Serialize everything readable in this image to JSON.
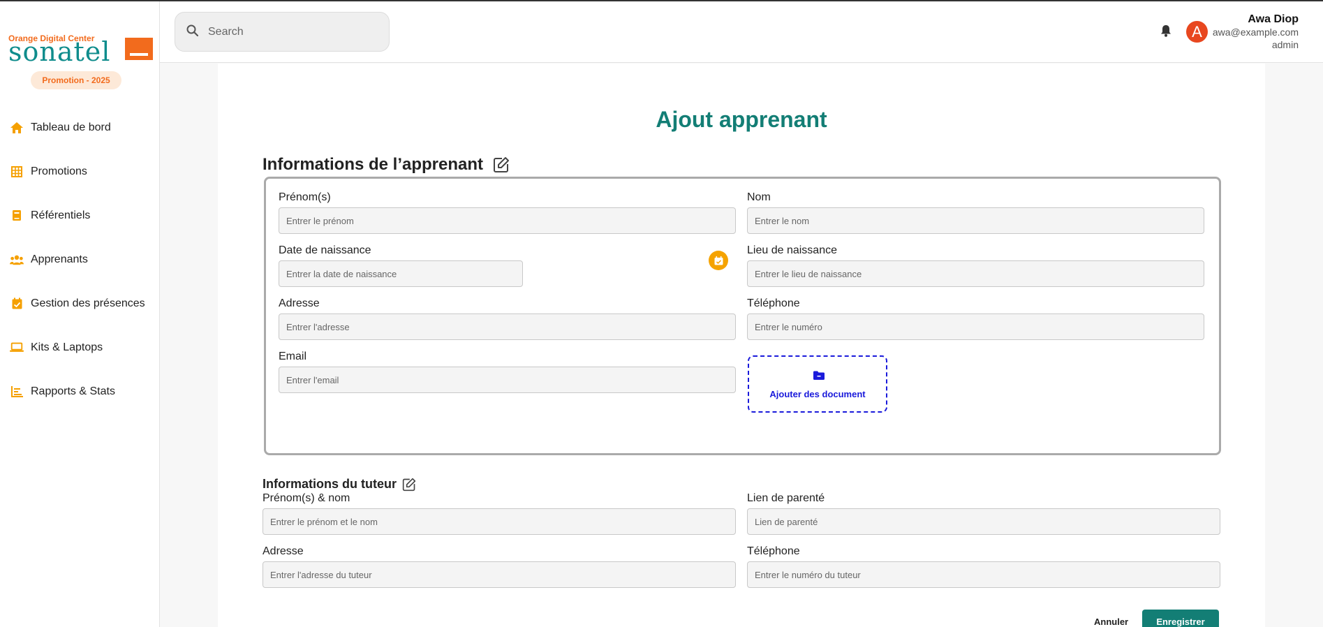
{
  "sidebar": {
    "logo_subtitle": "Orange Digital Center",
    "logo_text": "sonatel",
    "promotion_badge": "Promotion - 2025",
    "items": [
      {
        "label": "Tableau de bord",
        "icon": "home-icon"
      },
      {
        "label": "Promotions",
        "icon": "grid-icon"
      },
      {
        "label": "Référentiels",
        "icon": "book-icon"
      },
      {
        "label": "Apprenants",
        "icon": "users-icon"
      },
      {
        "label": "Gestion des présences",
        "icon": "calendar-check-icon"
      },
      {
        "label": "Kits & Laptops",
        "icon": "laptop-icon"
      },
      {
        "label": "Rapports & Stats",
        "icon": "bar-chart-icon"
      }
    ]
  },
  "header": {
    "search_placeholder": "Search",
    "user": {
      "initial": "A",
      "name": "Awa Diop",
      "email": "awa@example.com",
      "role": "admin"
    }
  },
  "form": {
    "title": "Ajout apprenant",
    "learner_section": {
      "title": "Informations de l’apprenant",
      "fields": {
        "prenom": {
          "label": "Prénom(s)",
          "placeholder": "Entrer le prénom",
          "value": ""
        },
        "nom": {
          "label": "Nom",
          "placeholder": "Entrer le nom",
          "value": ""
        },
        "date_naissance": {
          "label": "Date de naissance",
          "placeholder": "Entrer la date de naissance",
          "value": ""
        },
        "lieu_naissance": {
          "label": "Lieu de naissance",
          "placeholder": "Entrer le lieu de naissance",
          "value": ""
        },
        "adresse": {
          "label": "Adresse",
          "placeholder": "Entrer l'adresse",
          "value": ""
        },
        "telephone": {
          "label": "Téléphone",
          "placeholder": "Entrer le numéro",
          "value": ""
        },
        "email": {
          "label": "Email",
          "placeholder": "Entrer l'email",
          "value": ""
        }
      },
      "upload_label": "Ajouter des document"
    },
    "tutor_section": {
      "title": "Informations du tuteur",
      "fields": {
        "prenom_nom": {
          "label": "Prénom(s) & nom",
          "placeholder": "Entrer le prénom et le nom",
          "value": ""
        },
        "lien_parente": {
          "label": "Lien de parenté",
          "placeholder": "Lien de parenté",
          "value": ""
        },
        "adresse": {
          "label": "Adresse",
          "placeholder": "Entrer l'adresse du tuteur",
          "value": ""
        },
        "telephone": {
          "label": "Téléphone",
          "placeholder": "Entrer le numéro du tuteur",
          "value": ""
        }
      }
    },
    "actions": {
      "cancel": "Annuler",
      "save": "Enregistrer"
    }
  },
  "colors": {
    "brand_orange": "#f26b1d",
    "brand_teal": "#137e75",
    "upload_blue": "#1a1adb",
    "calendar_yellow": "#f5a300",
    "avatar_red": "#e8471f"
  }
}
